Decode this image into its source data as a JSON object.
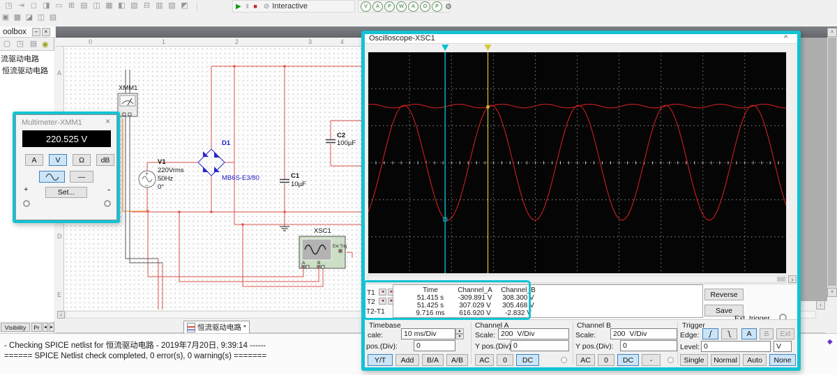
{
  "toolbar": {
    "row1_icons": [
      "◳",
      "⇥",
      "◻",
      "◨",
      "▭",
      "⊞",
      "▤",
      "◫",
      "▦",
      "◧",
      "▧",
      "⊟",
      "▥",
      "▨",
      "◩"
    ],
    "row2_icons": [
      "▣",
      "▩",
      "◪",
      "◫",
      "▤"
    ],
    "play": "▶",
    "pause": "‖",
    "stop": "■",
    "interactive_icon": "⊘",
    "interactive": "Interactive",
    "probes": [
      "V",
      "A",
      "P",
      "W",
      "A",
      "O",
      "P"
    ],
    "gear": "⚙"
  },
  "toolbox": {
    "title": "oolbox",
    "min": "–",
    "close": "×",
    "panel_icons": [
      "▢",
      "◳",
      "▤"
    ],
    "special_icon": "◉",
    "items": [
      {
        "label": "流驱动电路"
      },
      {
        "label": "恒流驱动电路"
      }
    ],
    "tab_visibility": "Visibility",
    "tab_pr": "Pr",
    "arrow_left": "◄",
    "arrow_right": "►"
  },
  "circuit": {
    "ruler_numbers": [
      "0",
      "1",
      "2",
      "3",
      "4"
    ],
    "ruler_letters": [
      "A",
      "D",
      "E"
    ],
    "xmm1": "XMM1",
    "v1": {
      "ref": "V1",
      "value": "220Vrms",
      "freq": "50Hz",
      "phase": "0°"
    },
    "d1": {
      "ref": "D1",
      "part": "MB6S-E3/80"
    },
    "c1": {
      "ref": "C1",
      "val": "10µF"
    },
    "c2": {
      "ref": "C2",
      "val": "100µF"
    },
    "xsc1": {
      "ref": "XSC1",
      "ext": "Ext Trig",
      "a": "A",
      "b": "B"
    }
  },
  "multimeter": {
    "title": "Multimeter-XMM1",
    "close": "×",
    "display": "220.525 V",
    "btn_a": "A",
    "btn_v": "V",
    "btn_ohm": "Ω",
    "btn_db": "dB",
    "dash": "—",
    "set": "Set...",
    "plus": "+",
    "minus": "-"
  },
  "scope": {
    "title": "Oscilloscope-XSC1",
    "collapse": "^",
    "scroll_right": "›",
    "readout": {
      "h_time": "Time",
      "h_a": "Channel_A",
      "h_b": "Channel_B",
      "t1": "T1",
      "t2": "T2",
      "dt": "T2-T1",
      "left_arrow": "◄",
      "right_arrow": "►",
      "r1": {
        "time": "51.415 s",
        "a": "-309.891 V",
        "b": "308.300 V"
      },
      "r2": {
        "time": "51.425 s",
        "a": "307.029 V",
        "b": "305.468 V"
      },
      "r3": {
        "time": "9.716 ms",
        "a": "616.920 V",
        "b": "-2.832 V"
      }
    },
    "reverse": "Reverse",
    "save": "Save",
    "ext_trigger": "Ext. trigger",
    "timebase": {
      "title": "Timebase",
      "scale_label": "cale:",
      "scale": "10 ms/Div",
      "pos_label": "pos.(Div):",
      "pos": "0",
      "b0": "Y/T",
      "b1": "Add",
      "b2": "B/A",
      "b3": "A/B"
    },
    "cha": {
      "title": "Channel A",
      "scale_label": "Scale:",
      "scale": "200  V/Div",
      "pos_label": "Y pos.(Div):",
      "pos": "0",
      "b0": "AC",
      "b1": "0",
      "b2": "DC"
    },
    "chb": {
      "title": "Channel B",
      "scale_label": "Scale:",
      "scale": "200  V/Div",
      "pos_label": "Y pos.(Div):",
      "pos": "0",
      "b0": "AC",
      "b1": "0",
      "b2": "DC",
      "b3": "-"
    },
    "trigger": {
      "title": "Trigger",
      "edge_label": "Edge:",
      "rise": "ʃ",
      "a": "A",
      "b": "B",
      "ext": "Ext",
      "level_label": "Level:",
      "level": "0",
      "unit": "V",
      "m0": "Single",
      "m1": "Normal",
      "m2": "Auto",
      "m3": "None"
    }
  },
  "tabs": {
    "sheet": "恒流驱动电路 *",
    "scroll_left": "‹"
  },
  "status": {
    "line1": "- Checking SPICE netlist for 恒流驱动电路 - 2019年7月20日, 9:39:14 ------",
    "line2": "====== SPICE Netlist check completed, 0 error(s), 0 warning(s) ======="
  },
  "chart_data": {
    "type": "line",
    "title": "Oscilloscope-XSC1",
    "timebase": "10 ms/Div",
    "x_divisions": 10,
    "y_divisions": 6,
    "series": [
      {
        "name": "Channel_A",
        "waveform": "sine",
        "amplitude_v": 310,
        "frequency_hz": 50,
        "v_per_div": 200
      },
      {
        "name": "Channel_B",
        "waveform": "dc_with_ripple",
        "level_v": 306,
        "v_per_div": 200
      }
    ],
    "cursors": [
      {
        "id": "T1",
        "time_s": 51.415,
        "channel_a_v": -309.891,
        "channel_b_v": 308.3
      },
      {
        "id": "T2",
        "time_s": 51.425,
        "channel_a_v": 307.029,
        "channel_b_v": 305.468
      }
    ],
    "delta": {
      "time_ms": 9.716,
      "channel_a_v": 616.92,
      "channel_b_v": -2.832
    },
    "render": {
      "x_divs": 10,
      "y_divs": 6,
      "a_amp_div": 1.55,
      "a_period_div": 2.08,
      "a_peak_div": 0.87,
      "b_level_div": 1.53,
      "b_ripple_div": 0.05,
      "cursor1_div": 1.85,
      "cursor2_div": 2.87,
      "trace_color": "#cc1f1f",
      "cursor1_color": "#00c2d4",
      "cursor2_color": "#d6c83c"
    }
  }
}
